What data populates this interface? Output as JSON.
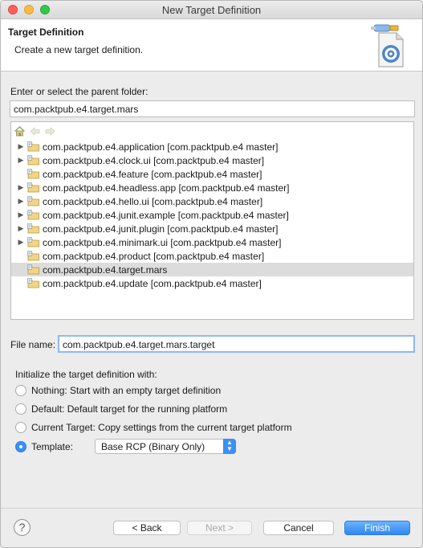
{
  "window": {
    "title": "New Target Definition"
  },
  "banner": {
    "title": "Target Definition",
    "description": "Create a new target definition."
  },
  "parent_folder": {
    "label": "Enter or select the parent folder:",
    "value": "com.packtpub.e4.target.mars"
  },
  "tree": {
    "toolbar": [
      "home-icon",
      "back-arrow-icon",
      "forward-arrow-icon"
    ],
    "items": [
      {
        "label": "com.packtpub.e4.application [com.packtpub.e4 master]",
        "expandable": true,
        "selected": false
      },
      {
        "label": "com.packtpub.e4.clock.ui [com.packtpub.e4 master]",
        "expandable": true,
        "selected": false
      },
      {
        "label": "com.packtpub.e4.feature [com.packtpub.e4 master]",
        "expandable": false,
        "selected": false
      },
      {
        "label": "com.packtpub.e4.headless.app [com.packtpub.e4 master]",
        "expandable": true,
        "selected": false
      },
      {
        "label": "com.packtpub.e4.hello.ui [com.packtpub.e4 master]",
        "expandable": true,
        "selected": false
      },
      {
        "label": "com.packtpub.e4.junit.example [com.packtpub.e4 master]",
        "expandable": true,
        "selected": false
      },
      {
        "label": "com.packtpub.e4.junit.plugin [com.packtpub.e4 master]",
        "expandable": true,
        "selected": false
      },
      {
        "label": "com.packtpub.e4.minimark.ui [com.packtpub.e4 master]",
        "expandable": true,
        "selected": false
      },
      {
        "label": "com.packtpub.e4.product [com.packtpub.e4 master]",
        "expandable": false,
        "selected": false
      },
      {
        "label": "com.packtpub.e4.target.mars",
        "expandable": false,
        "selected": true
      },
      {
        "label": "com.packtpub.e4.update [com.packtpub.e4 master]",
        "expandable": false,
        "selected": false
      }
    ]
  },
  "file_name": {
    "label": "File name:",
    "value": "com.packtpub.e4.target.mars.target"
  },
  "initialize": {
    "label": "Initialize the target definition with:",
    "options": [
      {
        "label": "Nothing: Start with an empty target definition",
        "checked": false
      },
      {
        "label": "Default: Default target for the running platform",
        "checked": false
      },
      {
        "label": "Current Target: Copy settings from the current target platform",
        "checked": false
      },
      {
        "label": "Template:",
        "checked": true
      }
    ],
    "template_selected": "Base RCP (Binary Only)"
  },
  "buttons": {
    "help": "?",
    "back": "< Back",
    "next": "Next >",
    "cancel": "Cancel",
    "finish": "Finish"
  },
  "colors": {
    "accent": "#3b8ff5",
    "selection": "#dcdcdc"
  }
}
